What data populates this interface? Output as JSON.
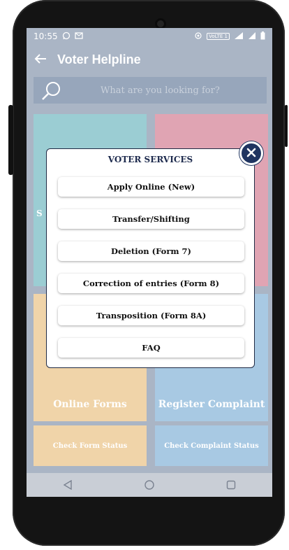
{
  "status_bar": {
    "time": "10:55",
    "badge_text": "VoLTE 1"
  },
  "app_bar": {
    "title": "Voter Helpline"
  },
  "search": {
    "placeholder": "What are you looking for?"
  },
  "tiles": {
    "top_left_peek": "S",
    "online_forms": "Online Forms",
    "register_complaint": "Register Complaint",
    "check_form_status": "Check Form Status",
    "check_complaint_status": "Check Complaint Status"
  },
  "modal": {
    "title": "VOTER SERVICES",
    "options": [
      "Apply Online (New)",
      "Transfer/Shifting",
      "Deletion (Form 7)",
      "Correction of entries (Form 8)",
      "Transposition (Form 8A)",
      "FAQ"
    ]
  },
  "icons": {
    "back": "back-arrow-icon",
    "search": "search-icon",
    "close": "close-icon",
    "nav_back": "triangle-back-icon",
    "nav_home": "circle-home-icon",
    "nav_recent": "square-recent-icon"
  },
  "colors": {
    "app_bar": "#aab5c5",
    "modal_border": "#1f2a44",
    "close_button": "#1f3460",
    "tile_teal": "#9bcdd3",
    "tile_pink": "#e0a4b3",
    "tile_peach": "#f0d4a9",
    "tile_blue": "#a8c9e3"
  }
}
